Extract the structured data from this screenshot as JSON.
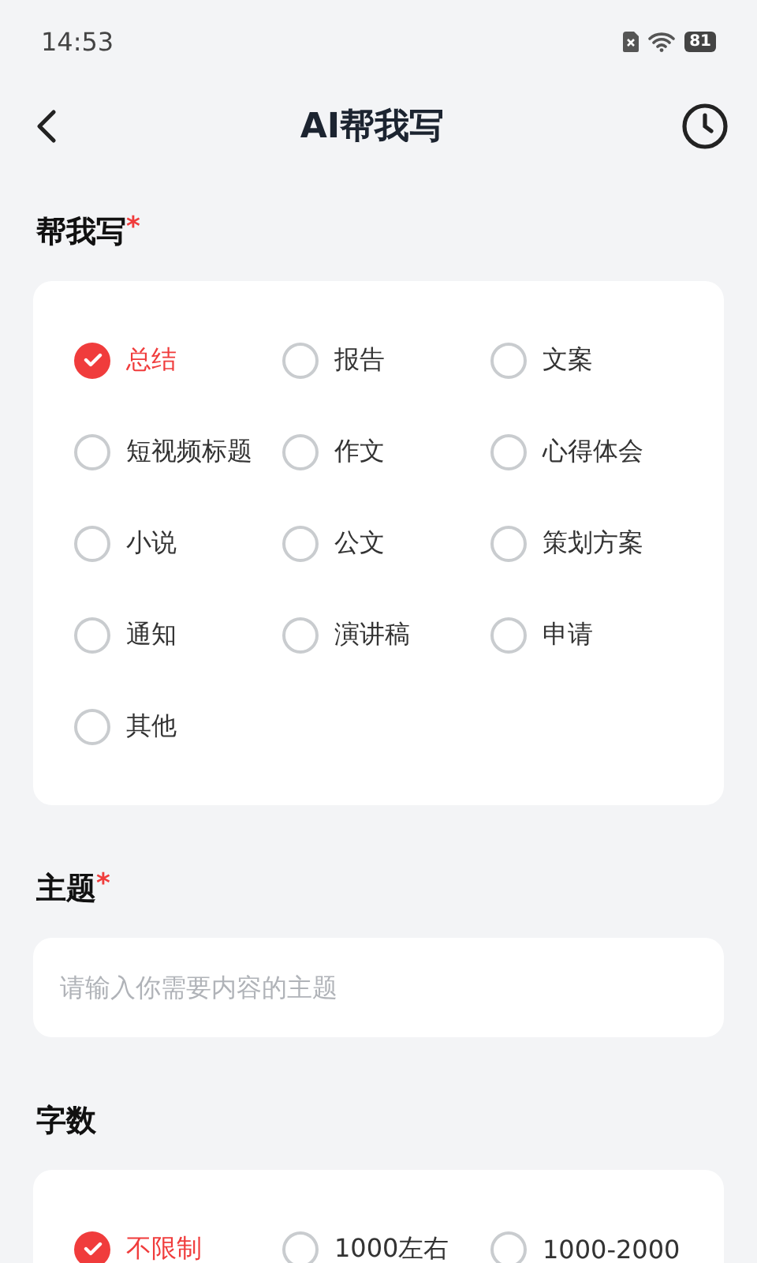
{
  "status_bar": {
    "time": "14:53",
    "battery": "81"
  },
  "header": {
    "title": "AI帮我写"
  },
  "sections": [
    {
      "kind": "options",
      "title": "帮我写",
      "required_mark": "*",
      "options": [
        {
          "label": "总结",
          "selected": true
        },
        {
          "label": "报告",
          "selected": false
        },
        {
          "label": "文案",
          "selected": false
        },
        {
          "label": "短视频标题",
          "selected": false
        },
        {
          "label": "作文",
          "selected": false
        },
        {
          "label": "心得体会",
          "selected": false
        },
        {
          "label": "小说",
          "selected": false
        },
        {
          "label": "公文",
          "selected": false
        },
        {
          "label": "策划方案",
          "selected": false
        },
        {
          "label": "通知",
          "selected": false
        },
        {
          "label": "演讲稿",
          "selected": false
        },
        {
          "label": "申请",
          "selected": false
        },
        {
          "label": "其他",
          "selected": false
        }
      ]
    },
    {
      "kind": "input",
      "title": "主题",
      "required_mark": "*",
      "placeholder": "请输入你需要内容的主题"
    },
    {
      "kind": "options",
      "title": "字数",
      "options": [
        {
          "label": "不限制",
          "selected": true
        },
        {
          "label": "1000左右",
          "selected": false
        },
        {
          "label": "1000-2000",
          "selected": false
        }
      ]
    }
  ]
}
